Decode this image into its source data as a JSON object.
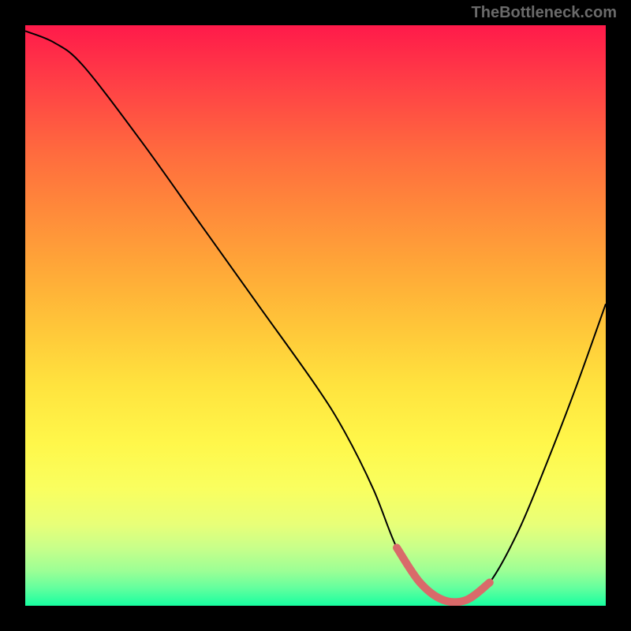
{
  "watermark": "TheBottleneck.com",
  "chart_data": {
    "type": "line",
    "title": "",
    "xlabel": "",
    "ylabel": "",
    "xlim": [
      0,
      100
    ],
    "ylim": [
      0,
      100
    ],
    "series": [
      {
        "name": "bottleneck-curve",
        "x": [
          0,
          5,
          10,
          20,
          30,
          40,
          50,
          55,
          60,
          64,
          68,
          72,
          76,
          80,
          85,
          90,
          95,
          100
        ],
        "values": [
          99,
          97,
          93,
          80,
          66,
          52,
          38,
          30,
          20,
          10,
          4,
          1,
          1,
          4,
          13,
          25,
          38,
          52
        ]
      }
    ],
    "annotations": [
      {
        "name": "optimal-range",
        "x_start": 64,
        "x_end": 80,
        "note": "pink highlighted trough"
      }
    ],
    "grid": false,
    "legend": false
  }
}
